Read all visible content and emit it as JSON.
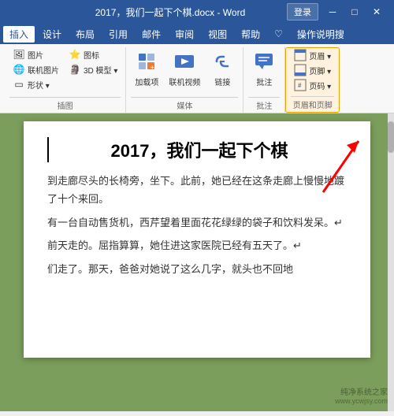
{
  "titleBar": {
    "title": "2017，我们一起下个棋.docx - Word",
    "loginLabel": "登录",
    "minBtn": "─",
    "maxBtn": "□",
    "closeBtn": "✕"
  },
  "menuBar": {
    "items": [
      {
        "label": "插入",
        "active": true
      },
      {
        "label": "设计",
        "active": false
      },
      {
        "label": "布局",
        "active": false
      },
      {
        "label": "引用",
        "active": false
      },
      {
        "label": "邮件",
        "active": false
      },
      {
        "label": "审阅",
        "active": false
      },
      {
        "label": "视图",
        "active": false
      },
      {
        "label": "帮助",
        "active": false
      },
      {
        "label": "♡",
        "active": false
      },
      {
        "label": "操作说明搜",
        "active": false
      }
    ]
  },
  "ribbon": {
    "groups": [
      {
        "name": "插图",
        "label": "插图",
        "items": [
          {
            "label": "图片",
            "icon": "🖼"
          },
          {
            "label": "图标",
            "icon": "⭐"
          },
          {
            "label": "联机图片",
            "icon": "🌐"
          },
          {
            "label": "3D 模型",
            "icon": "🗿"
          },
          {
            "label": "形状",
            "icon": "▭"
          }
        ]
      },
      {
        "name": "媒体",
        "label": "媒体",
        "items": [
          {
            "label": "加载项",
            "icon": "➕"
          },
          {
            "label": "联机视频",
            "icon": "▶"
          },
          {
            "label": "链接",
            "icon": "🔗"
          }
        ]
      },
      {
        "name": "批注",
        "label": "批注",
        "items": [
          {
            "label": "批注",
            "icon": "💬"
          }
        ]
      },
      {
        "name": "页眉页脚",
        "label": "页眉页脚",
        "items": [
          {
            "label": "页眉",
            "icon": "▤"
          },
          {
            "label": "页脚",
            "icon": "▤"
          },
          {
            "label": "页",
            "icon": "#"
          }
        ]
      }
    ]
  },
  "document": {
    "title": "2017，我们一起下个棋",
    "paragraphs": [
      "到走廊尽头的长椅旁，坐下。此前，她已经在这条走廊上慢慢地踱了十个来回。",
      "有一台自动售货机，西芹望着里面花花绿绿的袋子和饮料发呆。↵",
      "前天走的。屈指算算，她住进这家医院已经有五天了。↵",
      "们走了。那天，爸爸对她说了这么几字，就头也不回地"
    ]
  },
  "watermark": "纯净系统之家\nwww.ycwjsy.com",
  "arrowAnnotation": "points to 页眉页脚 group"
}
